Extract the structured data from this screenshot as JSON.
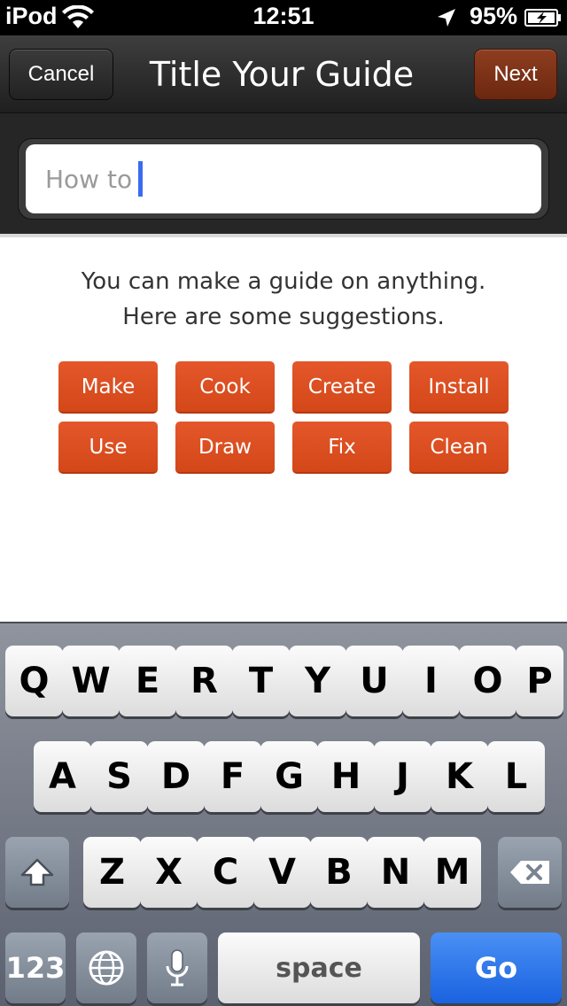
{
  "status_bar": {
    "carrier": "iPod",
    "time": "12:51",
    "battery_percent": "95%",
    "icons": [
      "wifi-icon",
      "location-arrow-icon",
      "battery-charging-icon"
    ]
  },
  "nav": {
    "cancel_label": "Cancel",
    "title": "Title Your Guide",
    "next_label": "Next"
  },
  "title_field": {
    "value": "How to"
  },
  "hint": {
    "line1": "You can make a guide on anything.",
    "line2": "Here are some suggestions."
  },
  "suggestions": [
    "Make",
    "Cook",
    "Create",
    "Install",
    "Use",
    "Draw",
    "Fix",
    "Clean"
  ],
  "keyboard": {
    "row1": [
      "Q",
      "W",
      "E",
      "R",
      "T",
      "Y",
      "U",
      "I",
      "O",
      "P"
    ],
    "row2": [
      "A",
      "S",
      "D",
      "F",
      "G",
      "H",
      "J",
      "K",
      "L"
    ],
    "row3": [
      "Z",
      "X",
      "C",
      "V",
      "B",
      "N",
      "M"
    ],
    "numbers_label": "123",
    "space_label": "space",
    "go_label": "Go",
    "special_icons": [
      "shift-icon",
      "backspace-icon",
      "globe-icon",
      "microphone-icon"
    ]
  },
  "colors": {
    "accent": "#d94c1e",
    "go_blue": "#1a62e0",
    "caret": "#3a6cf0"
  }
}
